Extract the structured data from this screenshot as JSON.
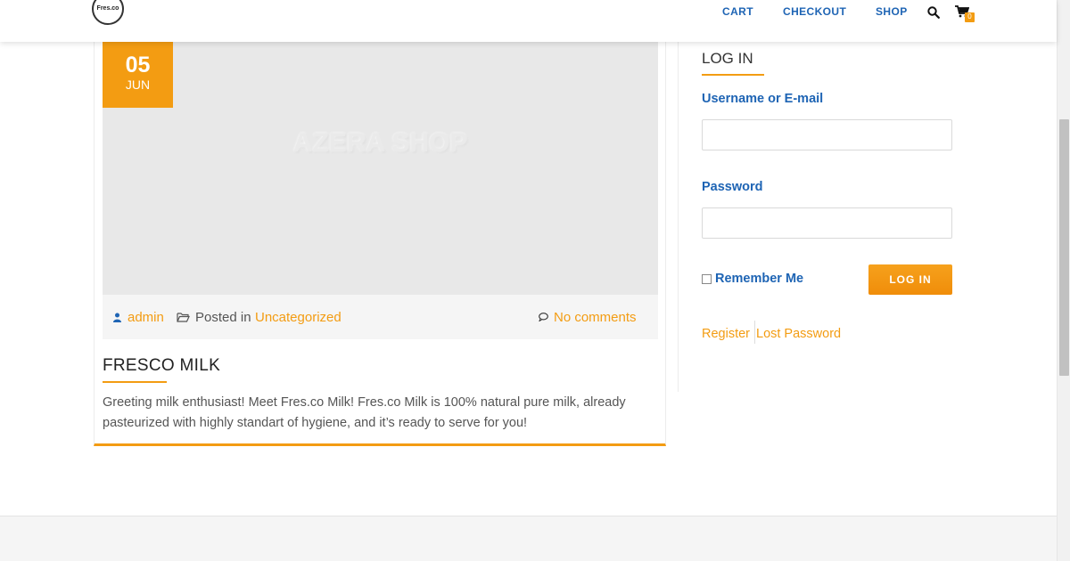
{
  "header": {
    "logo_text": "Fres.co",
    "nav": {
      "cart": "CART",
      "checkout": "CHECKOUT",
      "shop": "SHOP"
    },
    "icons": {
      "search": "search-icon",
      "cart": "cart-icon"
    },
    "cart_count": "0"
  },
  "post": {
    "watermark": "AZERA SHOP",
    "date": {
      "day": "05",
      "month": "JUN"
    },
    "meta": {
      "author": "admin",
      "posted_in": "Posted in",
      "category": "Uncategorized",
      "comments": "No comments"
    },
    "title": "FRESCO MILK",
    "excerpt": "Greeting milk enthusiast! Meet Fres.co Milk! Fres.co Milk is 100% natural pure milk, already pasteurized with highly standart of hygiene, and it’s ready to serve for you!"
  },
  "sidebar": {
    "title": "LOG IN",
    "username_label": "Username or E-mail",
    "username_value": "",
    "password_label": "Password",
    "password_value": "",
    "remember_label": "Remember Me",
    "login_button": "LOG IN",
    "register_link": "Register",
    "lost_password_link": "Lost Password"
  },
  "colors": {
    "accent": "#f39c12",
    "link_blue": "#1e64b4"
  }
}
